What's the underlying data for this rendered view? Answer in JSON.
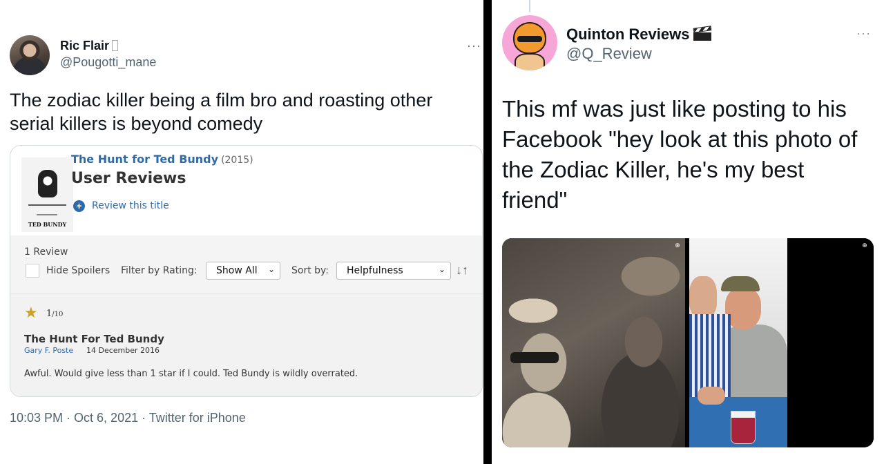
{
  "left_tweet": {
    "author_name": "Ric Flair",
    "author_badge": " ",
    "author_handle": "@Pougotti_mane",
    "more_icon": "···",
    "text": "The zodiac killer being a film bro and roasting other serial killers is beyond comedy",
    "meta": "10:03 PM · Oct 6, 2021 · Twitter for iPhone",
    "imdb": {
      "poster_title": "TED BUNDY",
      "movie_title": "The Hunt for Ted Bundy",
      "movie_year": "(2015)",
      "section_title": "User Reviews",
      "review_link": "Review this title",
      "review_count": "1 Review",
      "hide_spoilers": "Hide Spoilers",
      "filter_label": "Filter by Rating:",
      "filter_value": "Show All",
      "sort_label": "Sort by:",
      "sort_value": "Helpfulness",
      "review": {
        "rating": "1",
        "rating_scale": "/10",
        "title": "The Hunt For Ted Bundy",
        "author": "Gary F. Poste",
        "date": "14 December 2016",
        "body": "Awful. Would give less than 1 star if I could. Ted Bundy is wildly overrated."
      }
    }
  },
  "right_tweet": {
    "author_name": "Quinton Reviews",
    "author_handle": "@Q_Review",
    "more_icon": "···",
    "text": "This mf was just like posting to his Facebook \"hey look at this photo of the Zodiac Killer, he's my best friend\""
  },
  "icons": {
    "star": "★",
    "plus": "+",
    "caret": "⌄",
    "sort_dir": "↓↑",
    "zoom": "⊕"
  },
  "colors": {
    "imdb_link": "#2e6aa8",
    "star": "#c9a227",
    "twitter_secondary": "#536471"
  }
}
